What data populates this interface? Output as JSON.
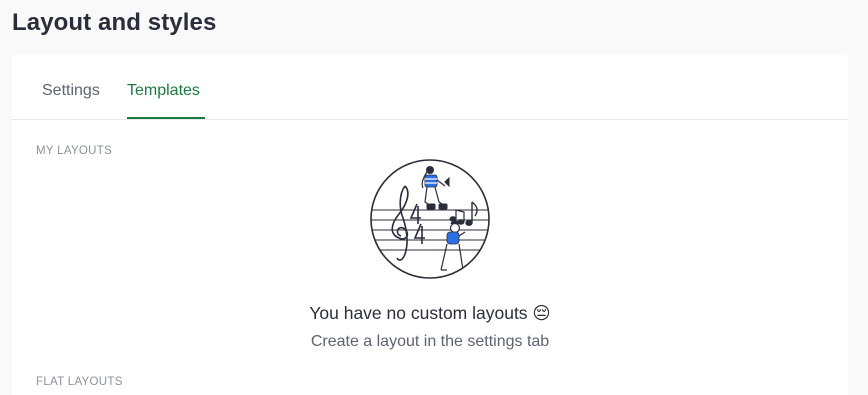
{
  "page": {
    "title": "Layout and styles"
  },
  "tabs": [
    {
      "label": "Settings",
      "active": false
    },
    {
      "label": "Templates",
      "active": true
    }
  ],
  "colors": {
    "accent": "#1b7a3f",
    "illustration_blue": "#2f6fe4",
    "text_dark": "#2a2d3a",
    "text_muted": "#5d6372"
  },
  "sections": {
    "my_layouts": {
      "label": "MY LAYOUTS",
      "empty_icon": "music-person-illustration",
      "empty_title": "You have no custom layouts 😔",
      "empty_subtitle": "Create a layout in the settings tab"
    },
    "flat_layouts": {
      "label": "FLAT LAYOUTS"
    }
  }
}
